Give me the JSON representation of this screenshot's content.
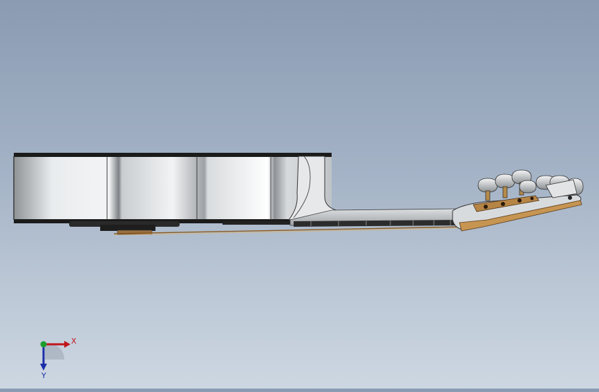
{
  "viewport": {
    "name": "cad-3d-viewport",
    "model": "guitar-side-view"
  },
  "triad": {
    "x_label": "X",
    "y_label": "Y",
    "x_color": "#c0161c",
    "y_color": "#1c2fa8",
    "z_color": "#1e9e2c"
  },
  "colors": {
    "background_top": "#8a9bb2",
    "background_bottom": "#cdd7e2",
    "body_silver": "#cfd3d6",
    "outline": "#1a1a1a",
    "wood": "#b88a4a"
  }
}
